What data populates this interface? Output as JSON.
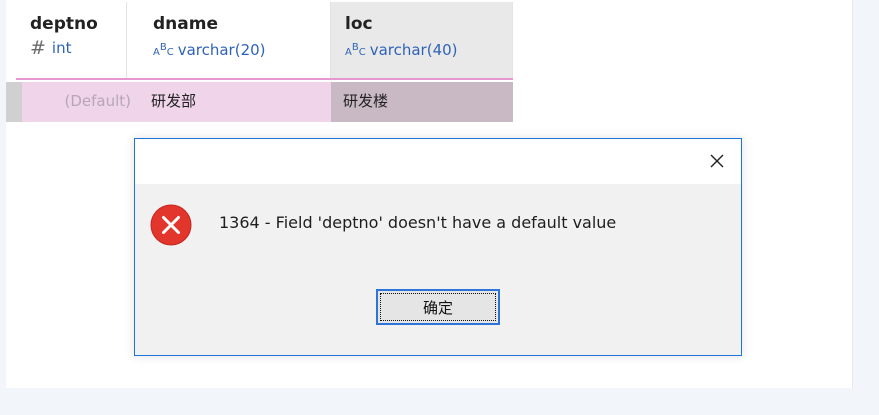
{
  "grid": {
    "columns": [
      {
        "name": "deptno",
        "type_icon": "hash-icon",
        "type": "int"
      },
      {
        "name": "dname",
        "type_icon": "abc-text-icon",
        "type": "varchar(20)"
      },
      {
        "name": "loc",
        "type_icon": "abc-text-icon",
        "type": "varchar(40)"
      }
    ],
    "row": {
      "deptno": "(Default)",
      "dname": "研发部",
      "loc": "研发楼"
    }
  },
  "dialog": {
    "icon": "error-icon",
    "message": "1364 - Field 'deptno' doesn't have a default value",
    "ok_label": "确定",
    "close_icon": "close-icon"
  },
  "colors": {
    "accent": "#1f74d6",
    "row_highlight": "#efd4ea",
    "header_underline": "#e796cf",
    "error_red": "#e2352c",
    "type_blue": "#2f63b8"
  }
}
